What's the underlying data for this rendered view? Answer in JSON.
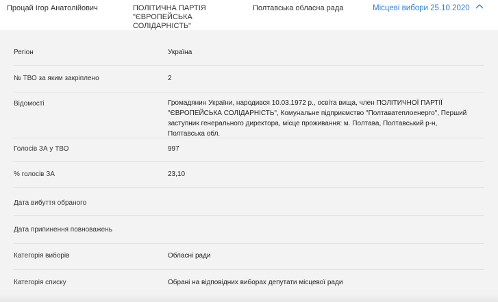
{
  "header": {
    "candidate_name": "Процай Ігор Анатолійович",
    "party_line1": "ПОЛІТИЧНА ПАРТІЯ",
    "party_line2": "\"ЄВРОПЕЙСЬКА СОЛІДАРНІСТЬ\"",
    "council": "Полтавська обласна рада",
    "election": "Місцеві вибори 25.10.2020",
    "toggle_icon": "chevron-up-icon"
  },
  "details": [
    {
      "label": "Регіон",
      "value": "Україна"
    },
    {
      "label": "№ ТВО за яким закріплено",
      "value": "2"
    },
    {
      "label": "Відомості",
      "value": "Громадянин України, народився 10.03.1972 р., освіта вища, член ПОЛІТИЧНОЇ ПАРТІЇ \"ЄВРОПЕЙСЬКА СОЛІДАРНІСТЬ\", Комунальне підприємство \"Полтаватеплоенерго\", Перший заступник генерального директора, місце проживання: м. Полтава, Полтавський р-н, Полтавська обл."
    },
    {
      "label": "Голосів ЗА у ТВО",
      "value": "997"
    },
    {
      "label": "% голосів ЗА",
      "value": "23,10"
    },
    {
      "label": "Дата вибуття обраного",
      "value": ""
    },
    {
      "label": "Дата припинення повноважень",
      "value": ""
    },
    {
      "label": "Категорія виборів",
      "value": "Обласні ради"
    },
    {
      "label": "Категорія списку",
      "value": "Обрані на відповідних виборах депутати місцевої ради"
    }
  ],
  "colors": {
    "link": "#2b7dd0",
    "panel_bg": "#f3f3f3"
  }
}
